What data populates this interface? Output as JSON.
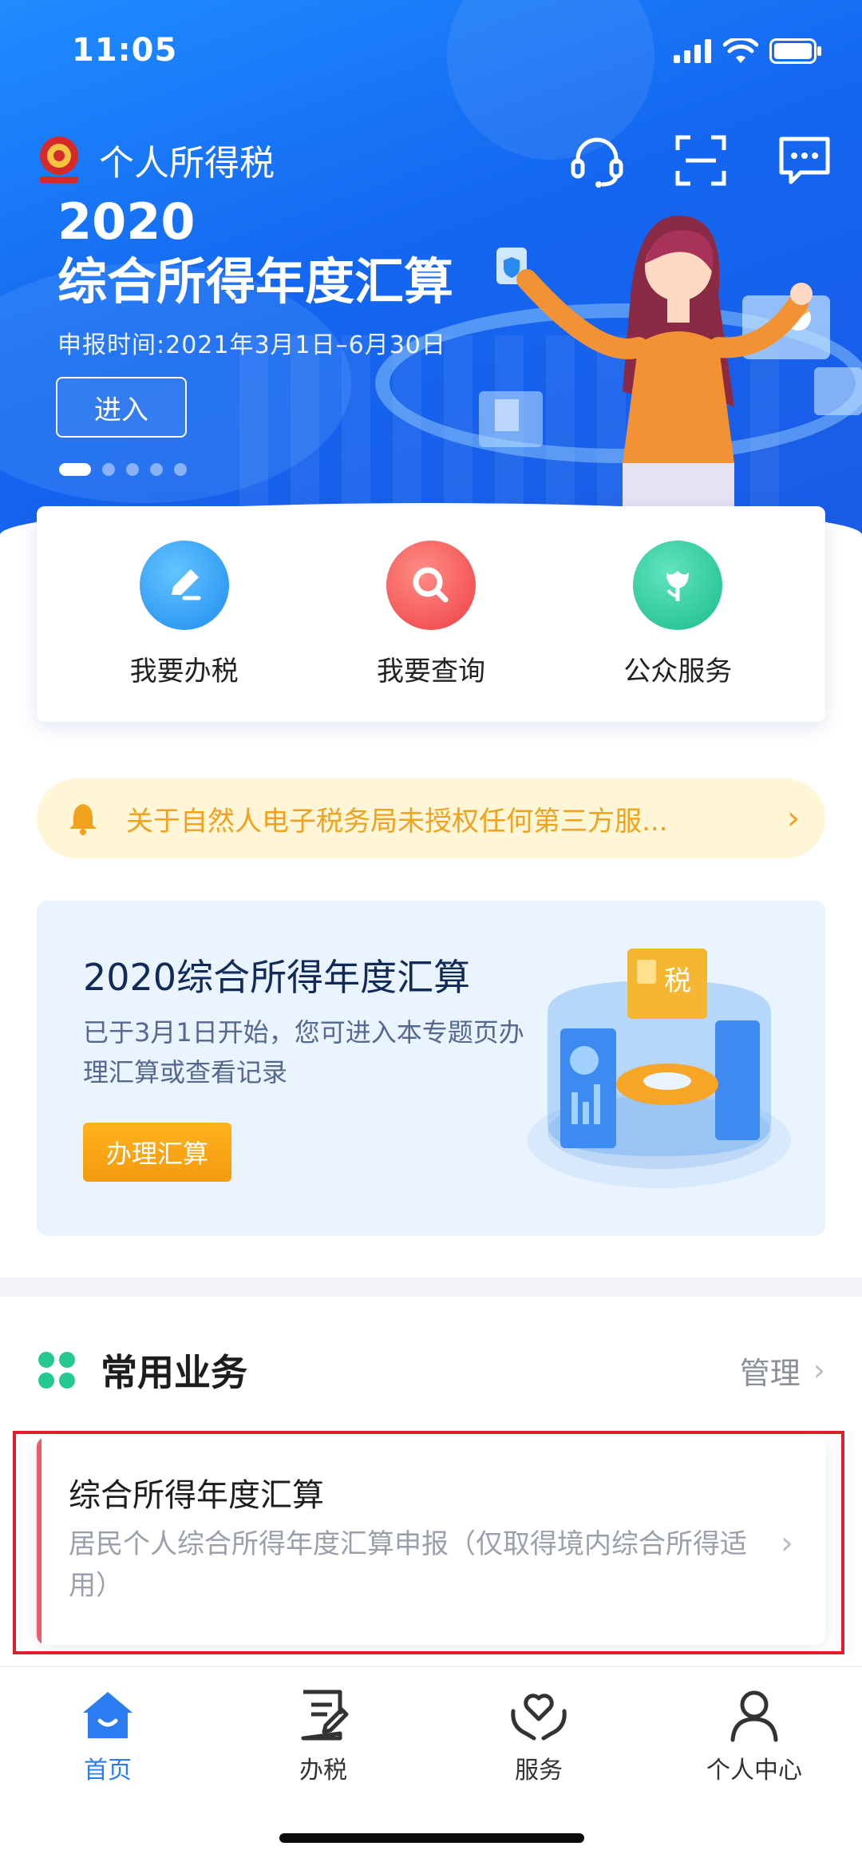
{
  "status_bar": {
    "time": "11:05"
  },
  "header": {
    "app_title": "个人所得税"
  },
  "banner": {
    "year": "2020",
    "headline": "综合所得年度汇算",
    "period": "申报时间:2021年3月1日–6月30日",
    "enter_label": "进入",
    "slide_index": 1,
    "slide_count": 5
  },
  "quick_actions": [
    {
      "label": "我要办税",
      "icon": "pen-edit-icon",
      "color": "#2a9cf2"
    },
    {
      "label": "我要查询",
      "icon": "magnifier-icon",
      "color": "#f55a55"
    },
    {
      "label": "公众服务",
      "icon": "tulip-icon",
      "color": "#21c99a"
    }
  ],
  "notice": {
    "text": "关于自然人电子税务局未授权任何第三方服...",
    "icon": "bell-icon"
  },
  "promo": {
    "title": "2020综合所得年度汇算",
    "desc": "已于3月1日开始，您可进入本专题页办理汇算或查看记录",
    "button_label": "办理汇算",
    "image_tag": "税"
  },
  "common_services": {
    "title": "常用业务",
    "manage_label": "管理",
    "items": [
      {
        "title": "综合所得年度汇算",
        "desc": "居民个人综合所得年度汇算申报（仅取得境内综合所得适用）"
      }
    ]
  },
  "tabbar": {
    "items": [
      {
        "label": "首页",
        "icon": "home-icon",
        "active": true
      },
      {
        "label": "办税",
        "icon": "document-edit-icon",
        "active": false
      },
      {
        "label": "服务",
        "icon": "heart-hand-icon",
        "active": false
      },
      {
        "label": "个人中心",
        "icon": "person-icon",
        "active": false
      }
    ]
  },
  "colors": {
    "primary": "#1466f0",
    "active_tab": "#2b7cf0",
    "notice": "#f0a21f",
    "highlight": "#e01e2b",
    "button_orange": "#f39a0d"
  }
}
